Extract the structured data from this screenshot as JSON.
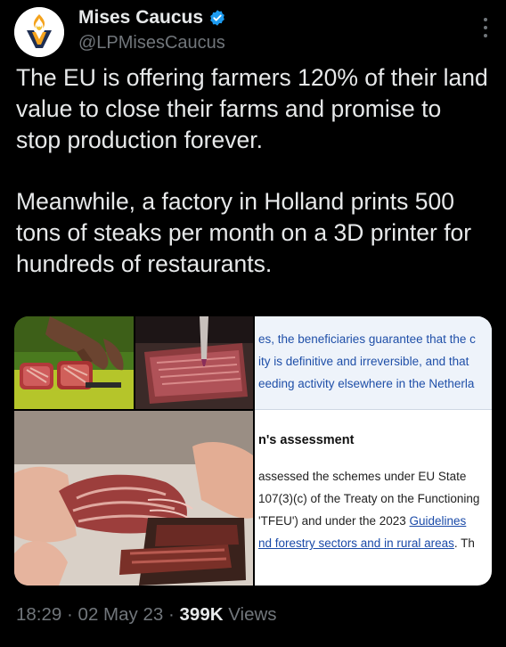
{
  "author": {
    "display_name": "Mises Caucus",
    "handle": "@LPMisesCaucus",
    "verified_icon": "verified-badge-icon",
    "avatar_icon": "torch-logo-icon"
  },
  "tweet": {
    "paragraph_1": "The EU is offering farmers 120% of their land value to close their farms and promise to stop production forever.",
    "paragraph_2": "Meanwhile, a factory in Holland prints 500 tons of steaks per month on a 3D printer for hundreds of restaurants."
  },
  "media": {
    "document_lines": [
      "es, the beneficiaries guarantee that the c",
      "ity is definitive and irreversible, and that",
      "eeding activity elsewhere in the Netherla"
    ],
    "document_heading": "n's assessment",
    "document_body": [
      "assessed the schemes under EU State",
      "107(3)(c) of the Treaty on the Functioning",
      "'TFEU') and under the 2023 ",
      "nd forestry sectors and in rural areas",
      ". Th"
    ],
    "document_link_1": "Guidelines"
  },
  "meta": {
    "time": "18:29",
    "separator": "·",
    "date": "02 May 23",
    "views_count": "399K",
    "views_label": "Views"
  },
  "colors": {
    "background": "#000000",
    "text": "#e7e9ea",
    "muted": "#71767b",
    "verified": "#1d9bf0"
  }
}
